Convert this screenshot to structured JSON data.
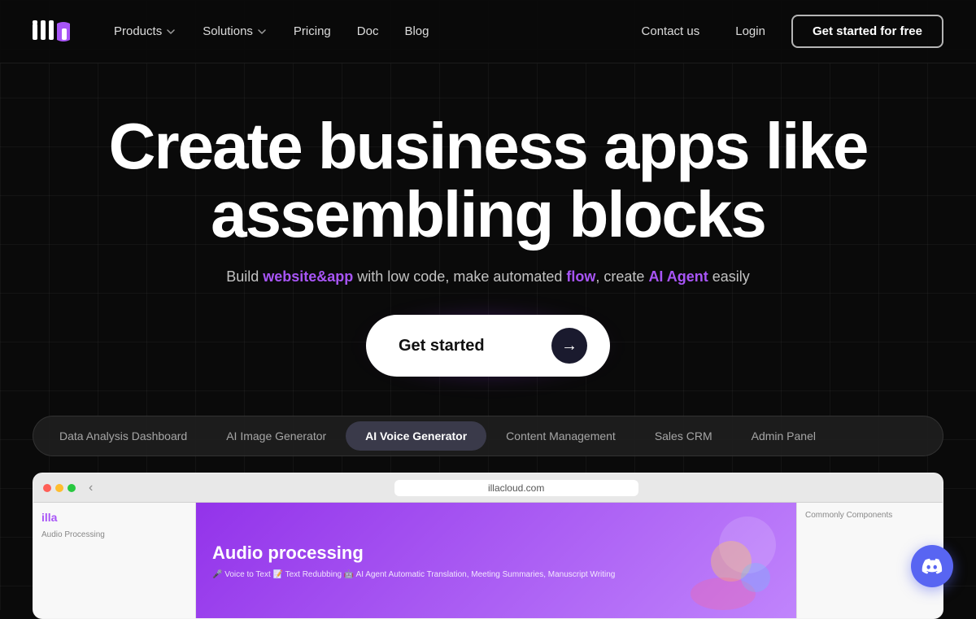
{
  "logo": {
    "text": "illa",
    "aria": "ILLA Cloud Logo"
  },
  "nav": {
    "products_label": "Products",
    "solutions_label": "Solutions",
    "pricing_label": "Pricing",
    "doc_label": "Doc",
    "blog_label": "Blog",
    "contact_label": "Contact us",
    "login_label": "Login",
    "get_started_label": "Get started for free"
  },
  "hero": {
    "title_line1": "Create business apps like",
    "title_line2": "assembling blocks",
    "subtitle_before": "Build ",
    "subtitle_website_app": "website&app",
    "subtitle_middle": " with low code, make automated ",
    "subtitle_flow": "flow",
    "subtitle_after": ", create ",
    "subtitle_ai": "AI Agent",
    "subtitle_end": " easily",
    "cta_label": "Get started"
  },
  "tabs": [
    {
      "label": "Data Analysis Dashboard",
      "active": false
    },
    {
      "label": "AI Image Generator",
      "active": false
    },
    {
      "label": "AI Voice Generator",
      "active": true
    },
    {
      "label": "Content Management",
      "active": false
    },
    {
      "label": "Sales CRM",
      "active": false
    },
    {
      "label": "Admin Panel",
      "active": false
    }
  ],
  "preview": {
    "url": "illacloud.com",
    "sidebar_logo": "illa",
    "sidebar_page": "Audio Processing",
    "main_title": "Audio processing",
    "main_subtitle": "🎤 Voice to Text 📝 Text Redubbing 🤖 AI Agent Automatic Translation, Meeting Summaries, Manuscript Writing",
    "right_panel_label": "Commonly Components"
  },
  "discord": {
    "aria": "Discord"
  }
}
